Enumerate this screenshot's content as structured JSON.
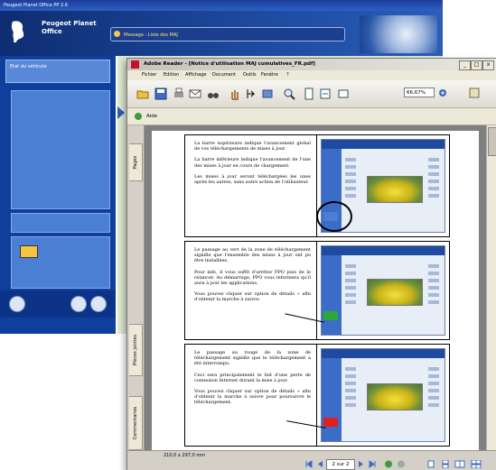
{
  "peugeot": {
    "window_title": "Peugeot Planet Office PP 2.6",
    "app_name_line1": "Peugeot Planet",
    "app_name_line2": "Office",
    "banner_text": "Message : Liste des MAJ",
    "sidebar_button": "Etat du véhicule"
  },
  "reader": {
    "window_title": "Adobe Reader - [Notice d'utilisation MAJ cumulatives_FR.pdf]",
    "menu": [
      "Fichier",
      "Edition",
      "Affichage",
      "Document",
      "Outils",
      "Fenêtre",
      "?"
    ],
    "zoom": "66,67%",
    "help_label": "Aide",
    "tabs": [
      "Pages",
      "Pièces jointes",
      "Commentaires"
    ],
    "page_size": "210,0 x 297,0 mm",
    "page_indicator": "2 sur 2",
    "title_buttons": [
      "_",
      "□",
      "x"
    ]
  },
  "document": {
    "sections": [
      {
        "paragraphs": [
          "La barre supérieure indique l'avancement global de vos téléchargements de mises à jour.",
          "La barre inférieure indique l'avancement de l'une des mises à jour en cours de chargement.",
          "Les mises à jour seront téléchargées les unes après les autres, sans autre action de l'utilisateur."
        ]
      },
      {
        "paragraphs": [
          "Le passage au vert de la zone de téléchargement signifie que l'ensemble des mises à jour ont pu être installées.",
          "Pour info, il vous suffit d'arrêter PPO puis de le relancer. Au démarrage, PPO vous informera qu'il aura à jour les applications.",
          "Vous pouvez cliquer sur option de détails » afin d'obtenir la marche à suivre."
        ]
      },
      {
        "paragraphs": [
          "Le passage au rouge de la zone de téléchargement signifie que le téléchargement a été interrompu.",
          "Ceci sera principalement le fait d'une perte de connexion Internet durant la mise à jour.",
          "Vous pouvez cliquer sur option de détails » afin d'obtenir la marche à suivre pour poursuivre le téléchargement."
        ]
      }
    ]
  },
  "colors": {
    "peugeot_blue": "#0f3f9c",
    "reader_chrome": "#d4d0c8",
    "status_green": "#2fa83a",
    "status_red": "#e02020"
  }
}
